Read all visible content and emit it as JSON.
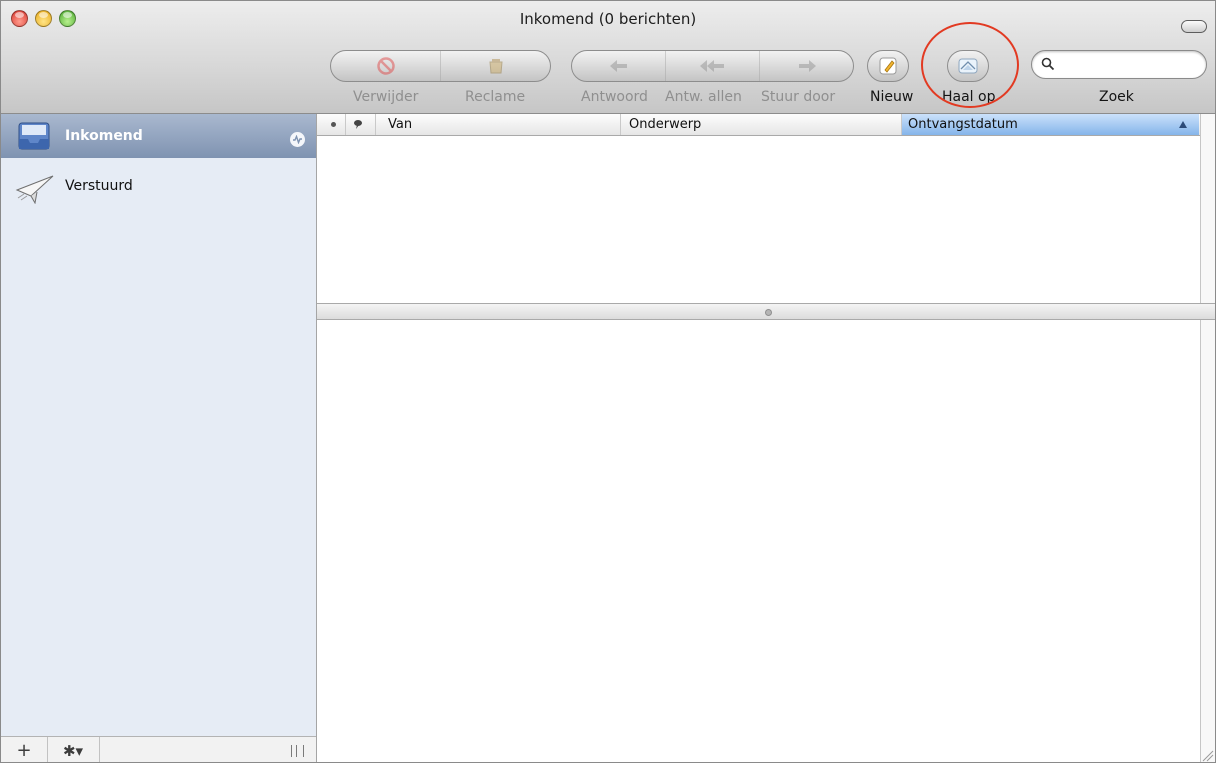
{
  "window": {
    "title": "Inkomend (0 berichten)"
  },
  "toolbar": {
    "delete_label": "Verwijder",
    "junk_label": "Reclame",
    "reply_label": "Antwoord",
    "reply_all_label": "Antw. allen",
    "forward_label": "Stuur door",
    "new_label": "Nieuw",
    "get_mail_label": "Haal op",
    "search_label": "Zoek",
    "search_value": ""
  },
  "sidebar": {
    "mailboxes": [
      {
        "label": "Inkomend",
        "icon": "inbox-tray-icon",
        "selected": true
      },
      {
        "label": "Verstuurd",
        "icon": "paper-plane-icon",
        "selected": false
      }
    ],
    "footer": {
      "add": "+",
      "action": "✱▾"
    }
  },
  "message_list": {
    "columns": [
      {
        "key": "unread",
        "label": ""
      },
      {
        "key": "flag",
        "label": ""
      },
      {
        "key": "from",
        "label": "Van"
      },
      {
        "key": "subject",
        "label": "Onderwerp"
      },
      {
        "key": "date",
        "label": "Ontvangstdatum",
        "sorted": true
      }
    ],
    "rows": []
  },
  "colors": {
    "sidebar_bg": "#e6ecf5",
    "selection": "#7f93b1",
    "sorted_column": "#85b5ea",
    "annotation": "#e23a22"
  }
}
